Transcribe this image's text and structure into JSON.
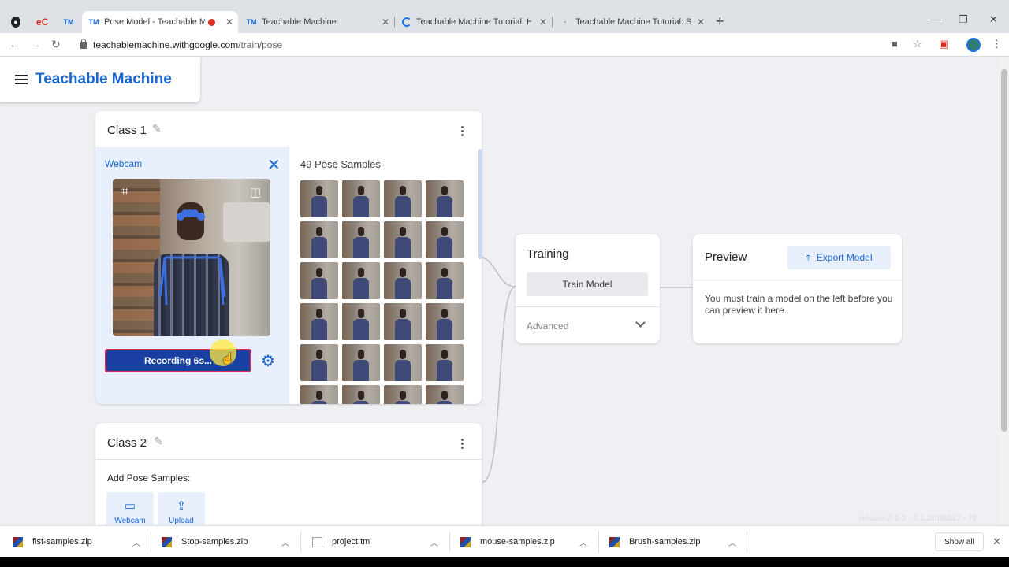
{
  "browser": {
    "tabs": [
      {
        "title": "",
        "favicon": "circle-logo"
      },
      {
        "title": "",
        "favicon": "eC"
      },
      {
        "title": "",
        "favicon": "TM"
      },
      {
        "title": "Pose Model - Teachable Mac",
        "favicon": "TM",
        "recording": true,
        "active": true
      },
      {
        "title": "Teachable Machine",
        "favicon": "TM"
      },
      {
        "title": "Teachable Machine Tutorial: Hea",
        "favicon": "loading"
      },
      {
        "title": "Teachable Machine Tutorial: Sna",
        "favicon": "loading"
      }
    ],
    "url_host": "teachablemachine.withgoogle.com",
    "url_path": "/train/pose"
  },
  "app": {
    "title": "Teachable Machine"
  },
  "class1": {
    "name": "Class 1",
    "webcam_label": "Webcam",
    "record_label": "Recording 6s...",
    "samples_label": "49 Pose Samples",
    "sample_count_visible": 24
  },
  "class2": {
    "name": "Class 2",
    "add_label": "Add Pose Samples:",
    "webcam_btn": "Webcam",
    "upload_btn": "Upload"
  },
  "training": {
    "title": "Training",
    "train_btn": "Train Model",
    "advanced": "Advanced"
  },
  "preview": {
    "title": "Preview",
    "export_btn": "Export Model",
    "message": "You must train a model on the left before you can preview it here."
  },
  "version": "release-2-1-2 - 2.1.2#d9bbc7 - 79",
  "downloads": {
    "items": [
      "fist-samples.zip",
      "Stop-samples.zip",
      "project.tm",
      "mouse-samples.zip",
      "Brush-samples.zip"
    ],
    "show_all": "Show all"
  },
  "colors": {
    "accent": "#1967d2",
    "record_button": "#1a3fa3",
    "page_bg": "#eef0f3"
  }
}
